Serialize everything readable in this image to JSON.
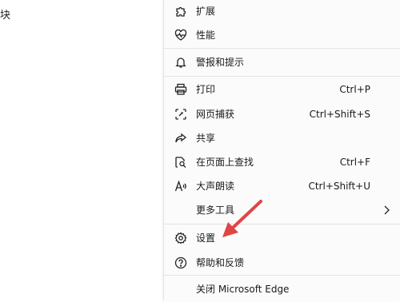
{
  "left_fragment": "块",
  "menu": {
    "items": [
      {
        "label": "扩展",
        "shortcut": "",
        "icon": "puzzle-icon"
      },
      {
        "label": "性能",
        "shortcut": "",
        "icon": "heartbeat-icon"
      },
      {
        "label": "警报和提示",
        "shortcut": "",
        "icon": "bell-icon"
      },
      {
        "label": "打印",
        "shortcut": "Ctrl+P",
        "icon": "printer-icon"
      },
      {
        "label": "网页捕获",
        "shortcut": "Ctrl+Shift+S",
        "icon": "capture-icon"
      },
      {
        "label": "共享",
        "shortcut": "",
        "icon": "share-icon"
      },
      {
        "label": "在页面上查找",
        "shortcut": "Ctrl+F",
        "icon": "find-icon"
      },
      {
        "label": "大声朗读",
        "shortcut": "Ctrl+Shift+U",
        "icon": "read-aloud-icon"
      },
      {
        "label": "更多工具",
        "shortcut": "",
        "icon": ""
      },
      {
        "label": "设置",
        "shortcut": "",
        "icon": "gear-icon"
      },
      {
        "label": "帮助和反馈",
        "shortcut": "",
        "icon": "help-icon"
      },
      {
        "label": "关闭 Microsoft Edge",
        "shortcut": "",
        "icon": ""
      }
    ]
  },
  "colors": {
    "arrow": "#e04545",
    "menu_bg": "#fbfbfb",
    "divider": "#e4e4e4"
  }
}
